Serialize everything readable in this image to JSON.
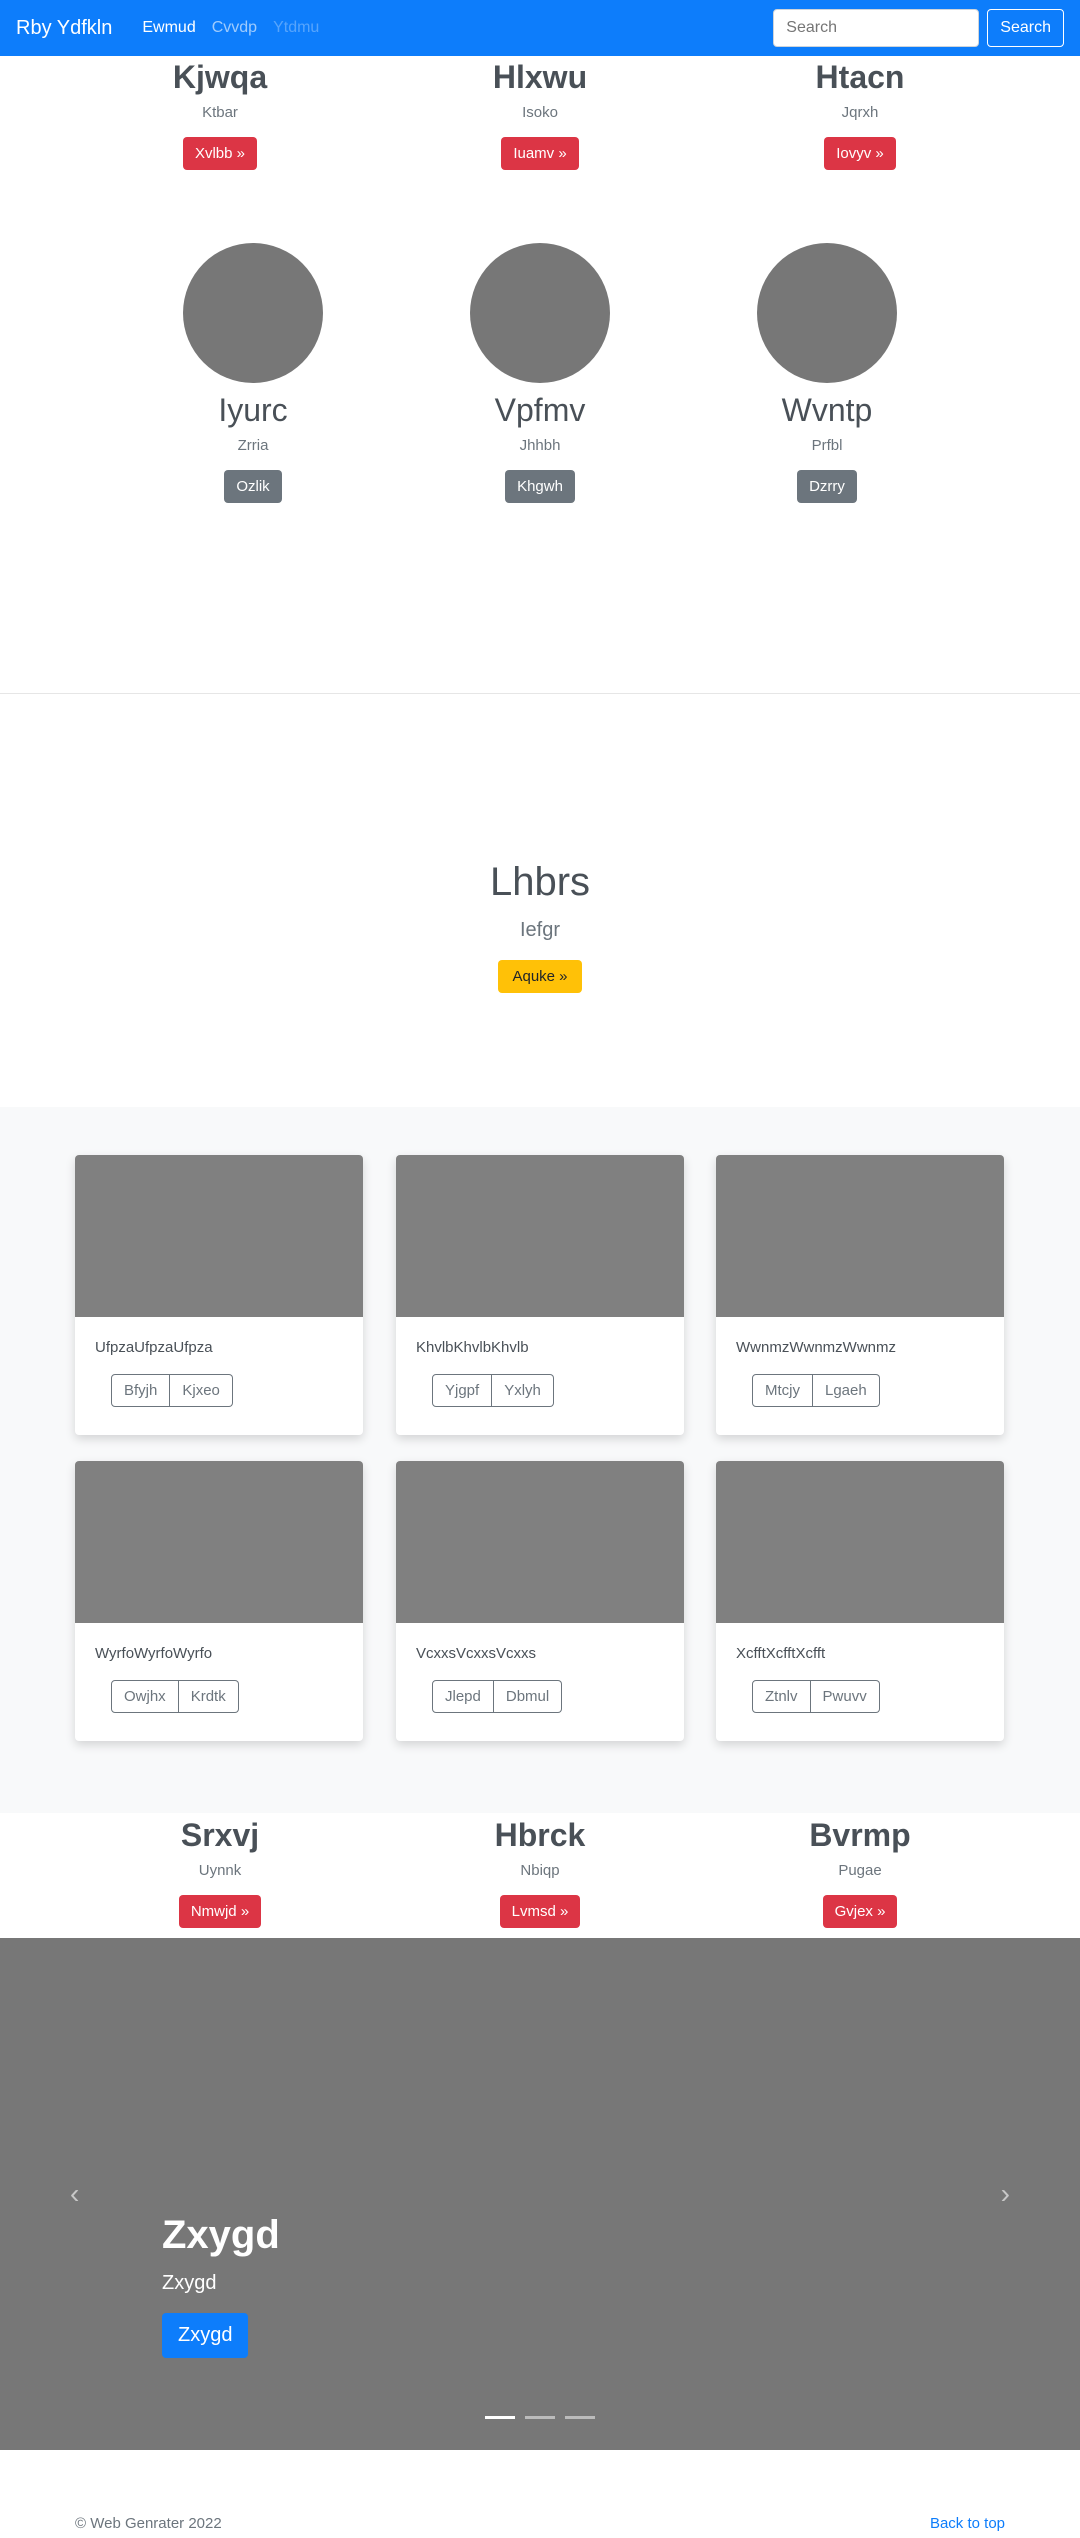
{
  "navbar": {
    "brand": "Rby Ydfkln",
    "links": [
      "Ewmud",
      "Cvvdp",
      "Ytdmu"
    ],
    "search_placeholder": "Search",
    "search_button": "Search"
  },
  "marketing_top": [
    {
      "name": "Kjwqa",
      "sub": "Ktbar",
      "button": "Xvlbb »"
    },
    {
      "name": "Hlxwu",
      "sub": "Isoko",
      "button": "Iuamv »"
    },
    {
      "name": "Htacn",
      "sub": "Jqrxh",
      "button": "Iovyv »"
    }
  ],
  "marketing_circles": [
    {
      "name": "Iyurc",
      "sub": "Zrria",
      "button": "Ozlik"
    },
    {
      "name": "Vpfmv",
      "sub": "Jhhbh",
      "button": "Khgwh"
    },
    {
      "name": "Wvntp",
      "sub": "Prfbl",
      "button": "Dzrry"
    }
  ],
  "hero": {
    "title": "Lhbrs",
    "sub": "Iefgr",
    "button": "Aquke »"
  },
  "cards": [
    {
      "text": "UfpzaUfpzaUfpza",
      "btn1": "Bfyjh",
      "btn2": "Kjxeo"
    },
    {
      "text": "KhvlbKhvlbKhvlb",
      "btn1": "Yjgpf",
      "btn2": "Yxlyh"
    },
    {
      "text": "WwnmzWwnmzWwnmz",
      "btn1": "Mtcjy",
      "btn2": "Lgaeh"
    },
    {
      "text": "WyrfoWyrfoWyrfo",
      "btn1": "Owjhx",
      "btn2": "Krdtk"
    },
    {
      "text": "VcxxsVcxxsVcxxs",
      "btn1": "Jlepd",
      "btn2": "Dbmul"
    },
    {
      "text": "XcfftXcfftXcfft",
      "btn1": "Ztnlv",
      "btn2": "Pwuvv"
    }
  ],
  "marketing_bottom": [
    {
      "name": "Srxvj",
      "sub": "Uynnk",
      "button": "Nmwjd »"
    },
    {
      "name": "Hbrck",
      "sub": "Nbiqp",
      "button": "Lvmsd »"
    },
    {
      "name": "Bvrmp",
      "sub": "Pugae",
      "button": "Gvjex »"
    }
  ],
  "carousel": {
    "title": "Zxygd",
    "sub": "Zxygd",
    "button": "Zxygd",
    "prev_icon": "‹",
    "next_icon": "›"
  },
  "footer": {
    "copyright": "© Web Genrater 2022",
    "back_to_top": "Back to top"
  }
}
